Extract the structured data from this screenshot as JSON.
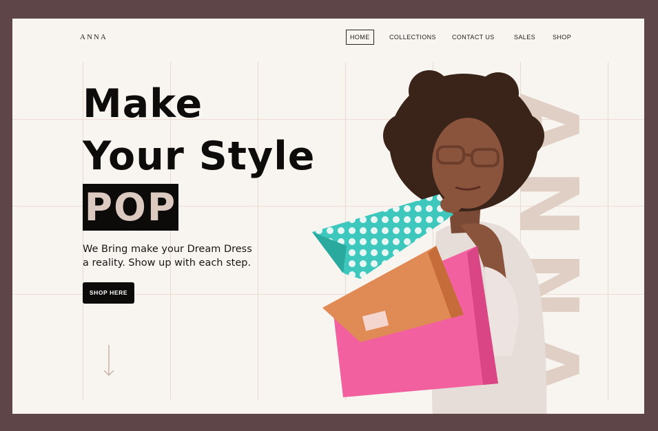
{
  "brand": {
    "logo": "ANNA",
    "vertical_text": "ANNA"
  },
  "nav": {
    "items": [
      {
        "label": "HOME",
        "active": true
      },
      {
        "label": "COLLECTIONS",
        "active": false
      },
      {
        "label": "CONTACT US",
        "active": false
      },
      {
        "label": "SALES",
        "active": false
      },
      {
        "label": "SHOP",
        "active": false
      }
    ]
  },
  "hero": {
    "title_line1": "Make",
    "title_line2": "Your Style",
    "highlight": "POP",
    "tagline_line1": "We Bring make your Dream Dress",
    "tagline_line2": "a reality. Show up with each step.",
    "cta_label": "SHOP HERE"
  },
  "colors": {
    "outer_frame": "#5e4547",
    "page_bg": "#f8f4f0",
    "accent_beige": "#dccac1",
    "text_dark": "#0e0b0b",
    "bag_pink": "#f2609f",
    "bag_orange": "#e08a55",
    "bag_teal": "#3ec7bd"
  },
  "icons": {
    "scroll": "arrow-down-icon"
  }
}
